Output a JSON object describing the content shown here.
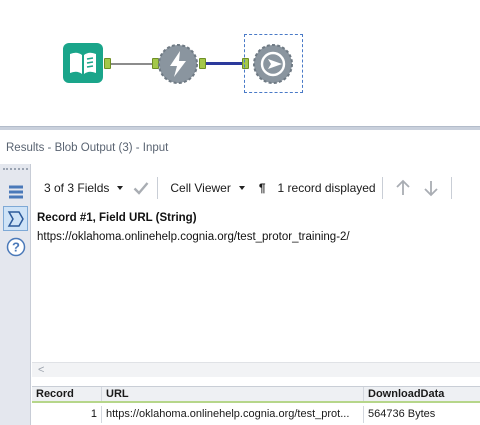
{
  "canvas": {
    "tools": [
      {
        "name": "Input Data",
        "icon": "book-icon",
        "color": "#1aa58a"
      },
      {
        "name": "Download",
        "icon": "lightning-icon",
        "color": "#8a959f"
      },
      {
        "name": "Blob Output",
        "icon": "gear-arrow-icon",
        "color": "#8a959f",
        "selected": true
      }
    ],
    "anchor_color": "#a4c84a",
    "selected_connection_color": "#2c3a9c"
  },
  "results": {
    "title": "Results - Blob Output (3) - Input",
    "toolbar": {
      "fields_label": "3 of 3 Fields",
      "viewer_label": "Cell Viewer",
      "pilcrow": "¶",
      "records_label": "1 record displayed"
    },
    "record_header": "Record #1, Field URL (String)",
    "cell_value": "https://oklahoma.onlinehelp.cognia.org/test_protor_training-2/",
    "scroll_left": "<",
    "grid": {
      "columns": [
        "Record",
        "URL",
        "DownloadData"
      ],
      "rows": [
        [
          "1",
          "https://oklahoma.onlinehelp.cognia.org/test_prot...",
          "564736 Bytes"
        ]
      ]
    }
  }
}
